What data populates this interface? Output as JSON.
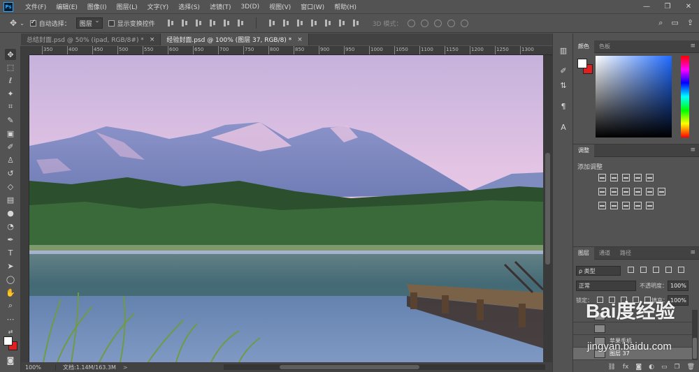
{
  "app": {
    "logo": "Ps"
  },
  "menu": [
    "文件(F)",
    "编辑(E)",
    "图像(I)",
    "图层(L)",
    "文字(Y)",
    "选择(S)",
    "滤镜(T)",
    "3D(D)",
    "视图(V)",
    "窗口(W)",
    "帮助(H)"
  ],
  "window_controls": {
    "minimize": "—",
    "restore": "❐",
    "close": "✕"
  },
  "options": {
    "auto_select_label": "自动选择：",
    "auto_select_target": "图层",
    "show_transform_label": "显示变换控件",
    "mode3d_label": "3D 模式："
  },
  "tabs": [
    {
      "label": "总结封面.psd @ 50% (ipad, RGB/8#) *",
      "close": "×"
    },
    {
      "label": "经验封面.psd @ 100% (图层 37, RGB/8) *",
      "close": "×"
    }
  ],
  "ruler_ticks": [
    "350",
    "400",
    "450",
    "500",
    "550",
    "600",
    "650",
    "700",
    "750",
    "800",
    "850",
    "900",
    "950",
    "1000",
    "1050",
    "1100",
    "1150",
    "1200",
    "1250",
    "1300"
  ],
  "status": {
    "zoom": "100%",
    "doc": "文档:1.14M/163.3M",
    "arrow": ">"
  },
  "panels": {
    "color_tabs": [
      "颜色",
      "色板"
    ],
    "adjust_tab": "调整",
    "adjust_title": "添加调整",
    "layers_tabs": [
      "图层",
      "通道",
      "路径"
    ],
    "filter_type": "ρ 类型",
    "blend_mode": "正常",
    "opacity_label": "不透明度：",
    "opacity_value": "100%",
    "lock_label": "锁定：",
    "fill_label": "填充：",
    "fill_value": "100%",
    "layers": [
      {
        "name": ""
      },
      {
        "name": ""
      },
      {
        "name": "苹果手机"
      },
      {
        "name": "图层 37"
      }
    ],
    "footer_icons": [
      "⛓",
      "fx",
      "◙",
      "◐",
      "▭",
      "❐",
      "🗑"
    ]
  },
  "watermark": {
    "brand": "Bai度经验",
    "url": "jingyan.baidu.com"
  },
  "colors": {
    "accent": "#31a8ff",
    "background": "#535353",
    "foreground_swatch": "#ffffff",
    "background_swatch": "#e02020"
  }
}
